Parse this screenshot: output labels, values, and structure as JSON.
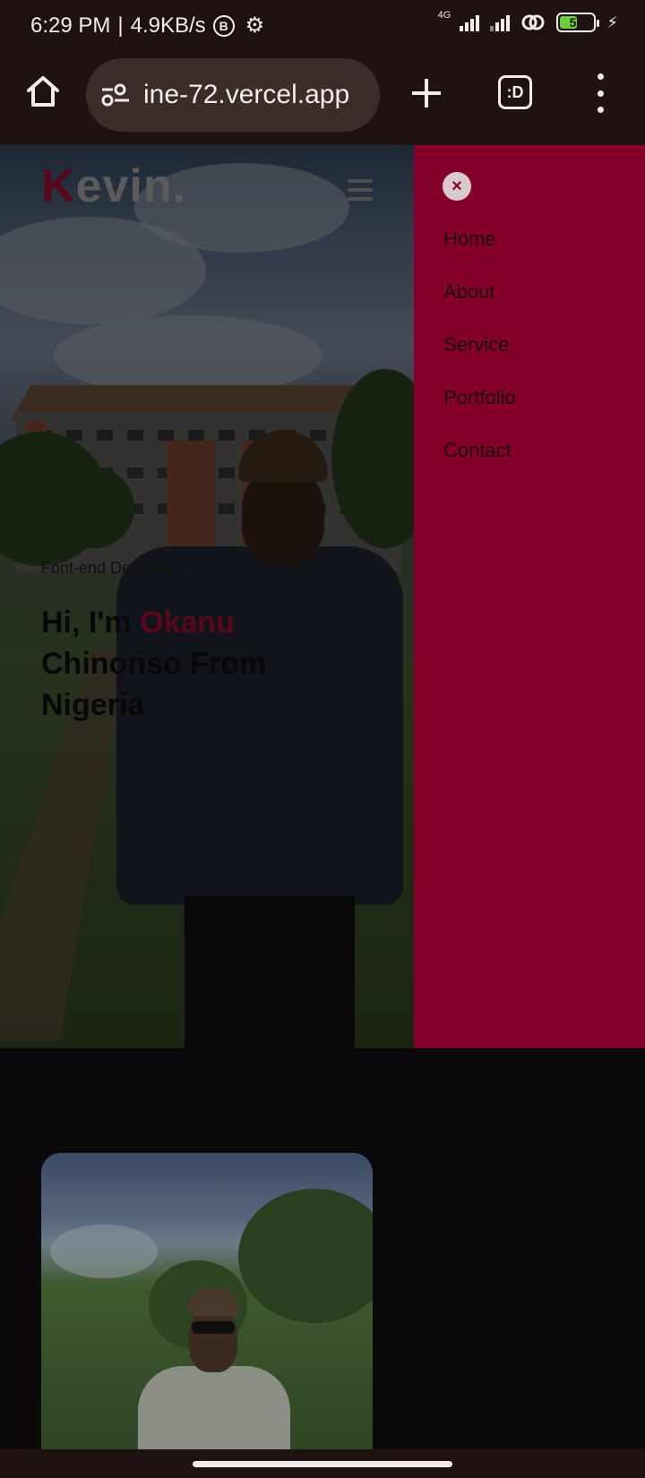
{
  "status_bar": {
    "time": "6:29 PM",
    "separator": "|",
    "speed": "4.9KB/s",
    "b_badge": "B",
    "network": "4G",
    "battery_level": "56",
    "battery_fraction": 0.56,
    "battery_color": "#6fcf3b"
  },
  "browser": {
    "url": "ine-72.vercel.app",
    "tab_count_label": ":D",
    "icons": [
      "home-icon",
      "site-settings-icon",
      "plus-icon",
      "tab-switcher-icon",
      "more-vert-icon"
    ]
  },
  "site": {
    "logo_initial": "K",
    "logo_rest": "evin.",
    "role": "Font-end Developer",
    "headline_prefix": "Hi, I'm ",
    "headline_name": "Okanu",
    "headline_suffix": "Chinonso From Nigeria",
    "accent_color": "#84002b"
  },
  "sidenav": {
    "close_label": "×",
    "items": [
      {
        "label": "Home"
      },
      {
        "label": "About"
      },
      {
        "label": "Service"
      },
      {
        "label": "Portfolio"
      },
      {
        "label": "Contact"
      }
    ]
  }
}
